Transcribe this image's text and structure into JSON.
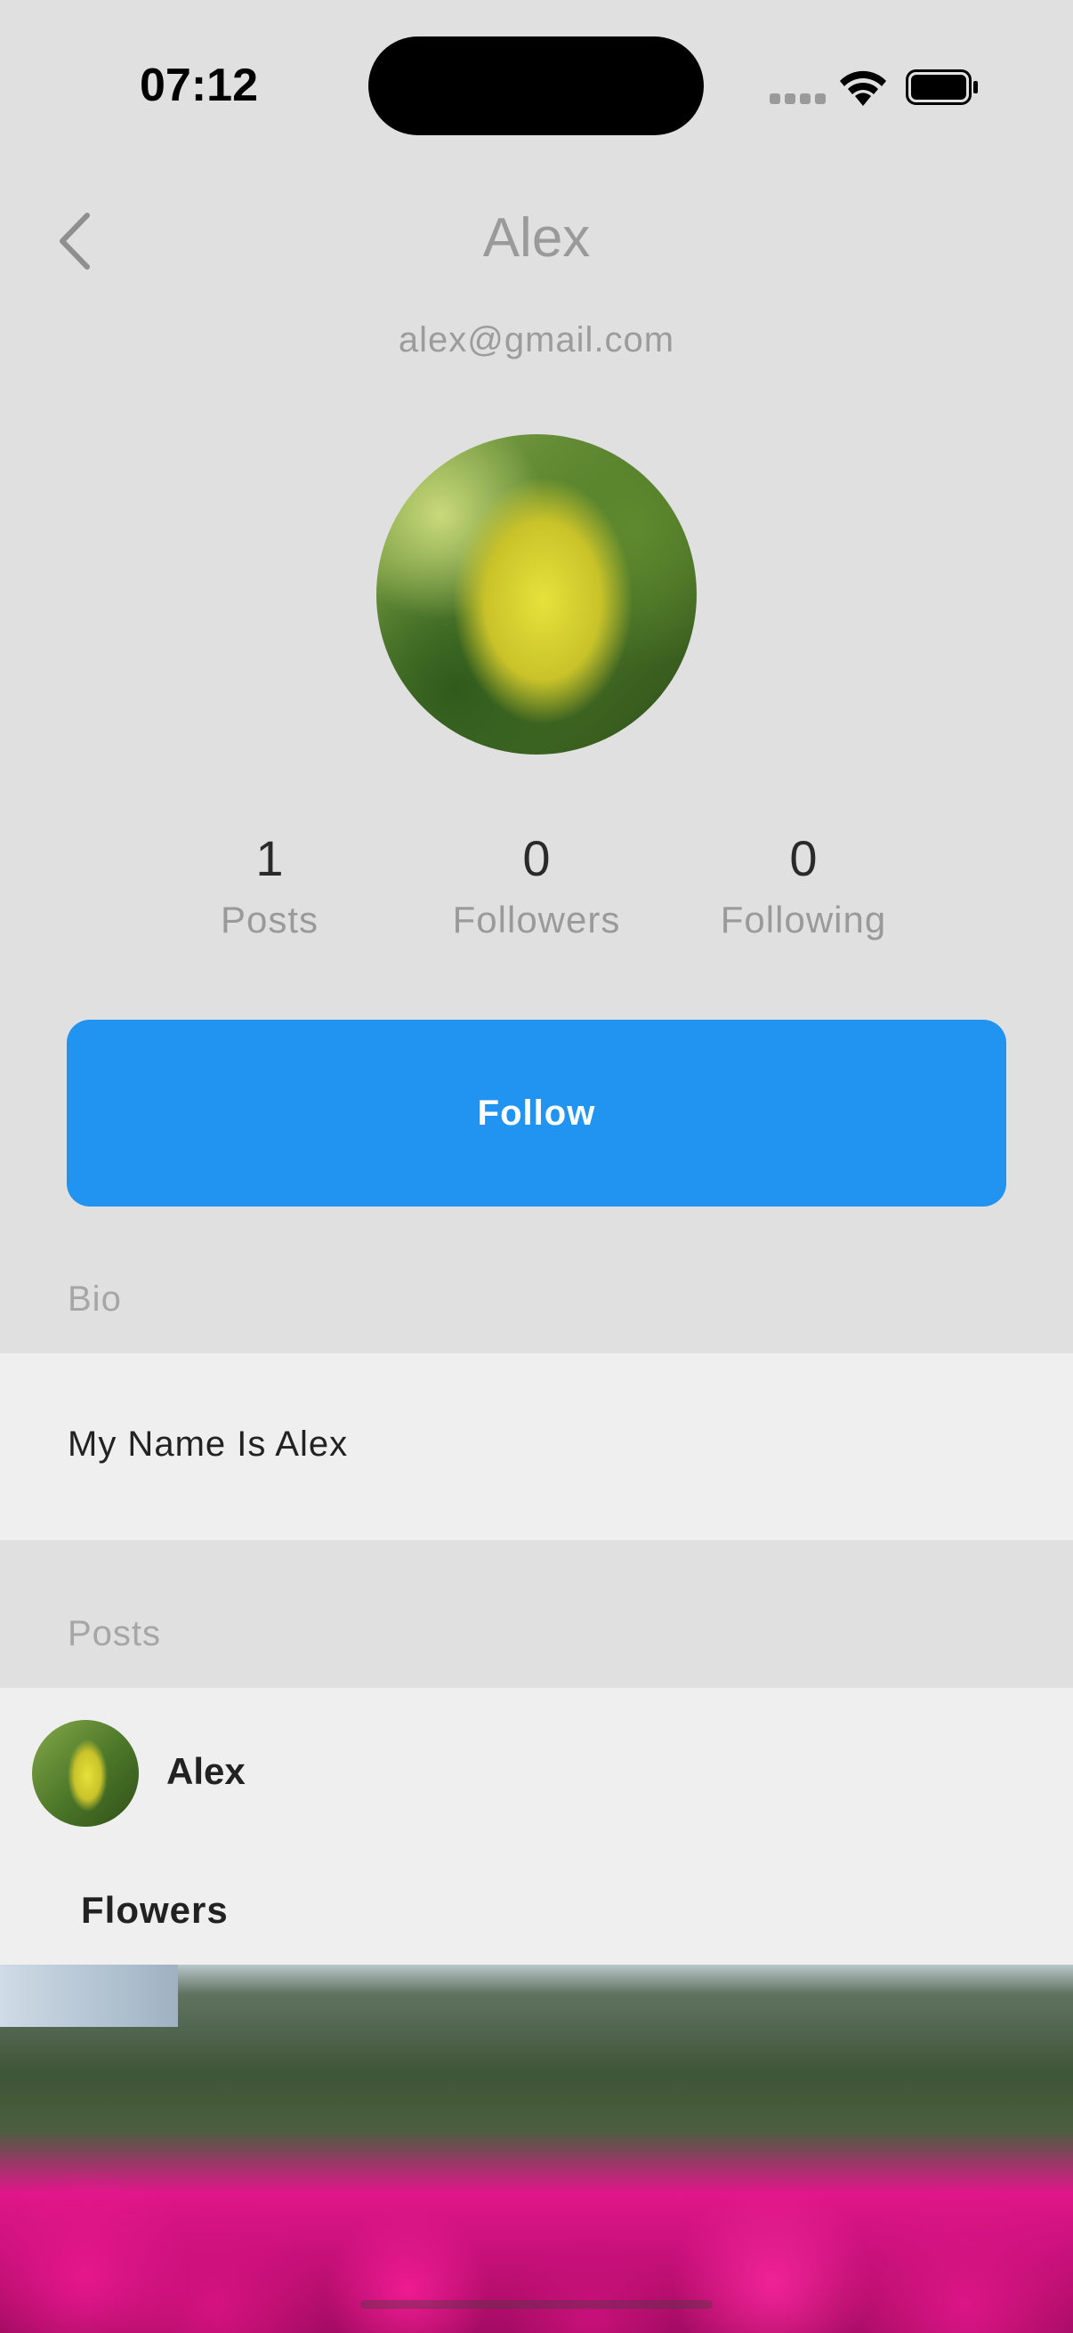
{
  "status_bar": {
    "time": "07:12"
  },
  "nav": {
    "title": "Alex",
    "back_icon": "chevron-left-icon"
  },
  "profile": {
    "email": "alex@gmail.com",
    "stats": [
      {
        "value": "1",
        "label": "Posts"
      },
      {
        "value": "0",
        "label": "Followers"
      },
      {
        "value": "0",
        "label": "Following"
      }
    ],
    "follow_label": "Follow"
  },
  "bio": {
    "section_label": "Bio",
    "text": "My Name Is Alex"
  },
  "posts": {
    "section_label": "Posts",
    "items": [
      {
        "author": "Alex",
        "title": "Flowers"
      }
    ]
  },
  "colors": {
    "accent": "#2193f0",
    "background": "#e0e0e0",
    "card": "#efefef"
  }
}
